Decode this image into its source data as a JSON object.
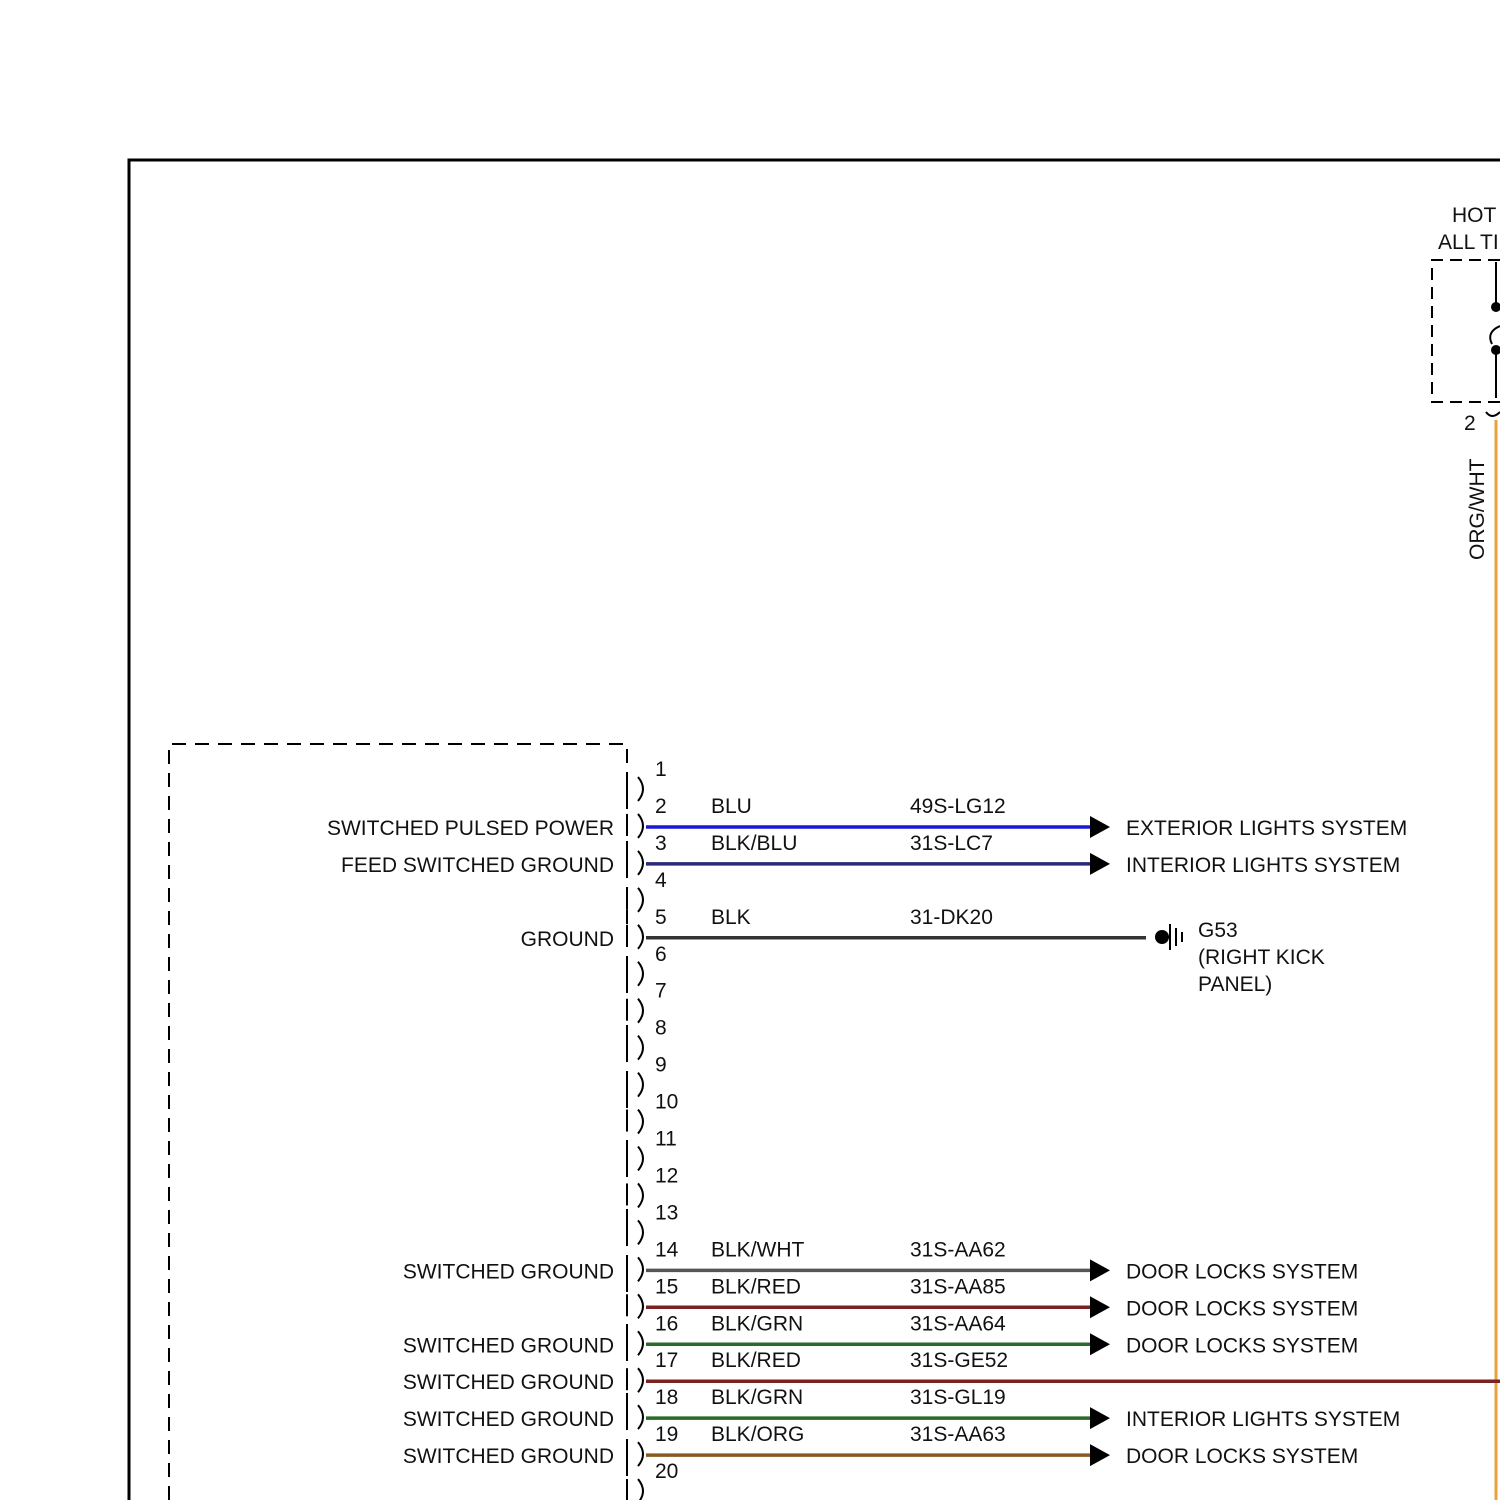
{
  "fuse_block": {
    "label_line1": "HOT",
    "label_line2": "ALL TI",
    "pin": "2",
    "wire_color_label": "ORG/WHT",
    "wire_color": "#E8A33C"
  },
  "module": {
    "pins": [
      "1",
      "2",
      "3",
      "4",
      "5",
      "6",
      "7",
      "8",
      "9",
      "10",
      "11",
      "12",
      "13",
      "14",
      "15",
      "16",
      "17",
      "18",
      "19",
      "20"
    ]
  },
  "circuits": [
    {
      "function": "SWITCHED PULSED POWER",
      "pin": "2",
      "color_label": "BLU",
      "circuit_id": "49S-LG12",
      "destination": "EXTERIOR LIGHTS SYSTEM",
      "stroke": "#1a1ad6"
    },
    {
      "function": "FEED SWITCHED GROUND",
      "pin": "3",
      "color_label": "BLK/BLU",
      "circuit_id": "31S-LC7",
      "destination": "INTERIOR LIGHTS SYSTEM",
      "stroke": "#2a2a7a"
    },
    {
      "function": "GROUND",
      "pin": "5",
      "color_label": "BLK",
      "circuit_id": "31-DK20",
      "destination": "",
      "stroke": "#333333"
    },
    {
      "function": "SWITCHED GROUND",
      "pin": "14",
      "color_label": "BLK/WHT",
      "circuit_id": "31S-AA62",
      "destination": "DOOR LOCKS SYSTEM",
      "stroke": "#555555"
    },
    {
      "function": "",
      "pin": "15",
      "color_label": "BLK/RED",
      "circuit_id": "31S-AA85",
      "destination": "DOOR LOCKS SYSTEM",
      "stroke": "#7a2222"
    },
    {
      "function": "SWITCHED GROUND",
      "pin": "16",
      "color_label": "BLK/GRN",
      "circuit_id": "31S-AA64",
      "destination": "DOOR LOCKS SYSTEM",
      "stroke": "#2a6a2a"
    },
    {
      "function": "SWITCHED GROUND",
      "pin": "17",
      "color_label": "BLK/RED",
      "circuit_id": "31S-GE52",
      "destination": "",
      "stroke": "#7a2222"
    },
    {
      "function": "SWITCHED GROUND",
      "pin": "18",
      "color_label": "BLK/GRN",
      "circuit_id": "31S-GL19",
      "destination": "INTERIOR LIGHTS SYSTEM",
      "stroke": "#2a6a2a"
    },
    {
      "function": "SWITCHED GROUND",
      "pin": "19",
      "color_label": "BLK/ORG",
      "circuit_id": "31S-AA63",
      "destination": "DOOR LOCKS SYSTEM",
      "stroke": "#8a5a22"
    }
  ],
  "ground_point": {
    "name": "G53",
    "location_line1": "(RIGHT KICK",
    "location_line2": "PANEL)"
  }
}
